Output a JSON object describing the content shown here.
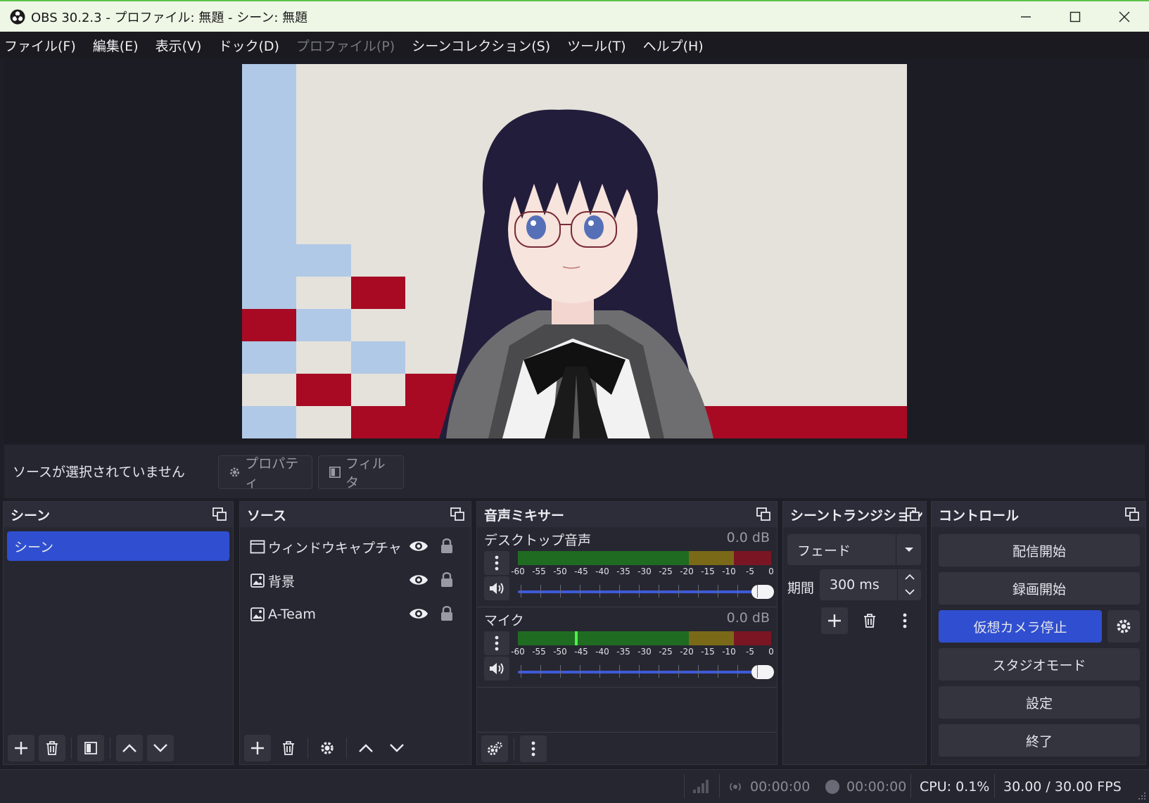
{
  "window": {
    "title": "OBS 30.2.3 - プロファイル: 無題 - シーン: 無題",
    "minimize": "—",
    "maximize": "☐",
    "close": "✕"
  },
  "menu": [
    {
      "label": "ファイル(F)",
      "disabled": false
    },
    {
      "label": "編集(E)",
      "disabled": false
    },
    {
      "label": "表示(V)",
      "disabled": false
    },
    {
      "label": "ドック(D)",
      "disabled": false
    },
    {
      "label": "プロファイル(P)",
      "disabled": true
    },
    {
      "label": "シーンコレクション(S)",
      "disabled": false
    },
    {
      "label": "ツール(T)",
      "disabled": false
    },
    {
      "label": "ヘルプ(H)",
      "disabled": false
    }
  ],
  "source_toolbar": {
    "no_selection": "ソースが選択されていません",
    "properties": "プロパティ",
    "filters": "フィルタ"
  },
  "scenes": {
    "title": "シーン",
    "items": [
      "シーン"
    ]
  },
  "sources": {
    "title": "ソース",
    "items": [
      {
        "label": "ウィンドウキャプチャ",
        "icon": "window-capture-icon"
      },
      {
        "label": "背景",
        "icon": "image-icon"
      },
      {
        "label": "A-Team",
        "icon": "image-icon"
      }
    ]
  },
  "mixer": {
    "title": "音声ミキサー",
    "ticks": [
      "-60",
      "-55",
      "-50",
      "-45",
      "-40",
      "-35",
      "-30",
      "-25",
      "-20",
      "-15",
      "-10",
      "-5",
      "0"
    ],
    "channels": [
      {
        "name": "デスクトップ音声",
        "db": "0.0 dB",
        "volume": 1.0
      },
      {
        "name": "マイク",
        "db": "0.0 dB",
        "volume": 1.0
      }
    ]
  },
  "transition": {
    "title": "シーントランジション",
    "selected": "フェード",
    "duration_label": "期間",
    "duration": "300 ms"
  },
  "controls": {
    "title": "コントロール",
    "start_stream": "配信開始",
    "start_record": "録画開始",
    "virtual_cam": "仮想カメラ停止",
    "studio_mode": "スタジオモード",
    "settings": "設定",
    "exit": "終了"
  },
  "status": {
    "stream_time": "00:00:00",
    "record_time": "00:00:00",
    "cpu": "CPU: 0.1%",
    "fps": "30.00 / 30.00 FPS"
  },
  "colors": {
    "accent": "#2f4fd0",
    "checker_blue": "#b0c9e6",
    "checker_red": "#a80a24",
    "checker_cream": "#e5e2db"
  }
}
